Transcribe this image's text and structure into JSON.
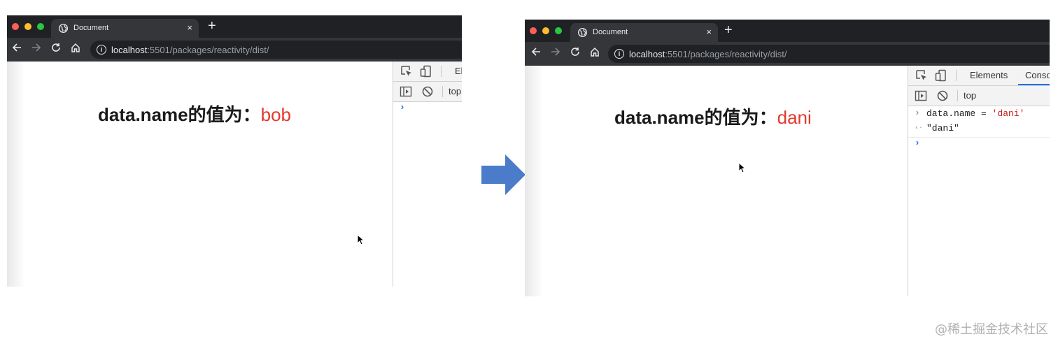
{
  "colors": {
    "tabbar": "#202124",
    "toolbar": "#35363a",
    "dot_close": "#fe5f57",
    "dot_min": "#febc2e",
    "dot_max": "#28c840",
    "value_red": "#e23a2d",
    "arrow_blue": "#4a7cc9",
    "console_string": "#c41a16",
    "console_prompt": "#1a73e8"
  },
  "before": {
    "tab": {
      "title": "Document",
      "close": "×"
    },
    "new_tab": "+",
    "url": {
      "host": "localhost",
      "path": ":5501/packages/reactivity/dist/"
    },
    "page": {
      "label": "data.name的值为：",
      "value": "bob"
    },
    "devtools": {
      "tab_elements": "El",
      "context": "top",
      "console_prompt": "›"
    }
  },
  "after": {
    "tab": {
      "title": "Document",
      "close": "×"
    },
    "new_tab": "+",
    "url": {
      "host": "localhost",
      "path": ":5501/packages/reactivity/dist/"
    },
    "page": {
      "label": "data.name的值为：",
      "value": "dani"
    },
    "devtools": {
      "tab_elements": "Elements",
      "tab_console": "Conso",
      "context": "top",
      "console": {
        "input_prefix": "›",
        "input_expr": "data.name",
        "input_op": "=",
        "input_str": "'dani'",
        "result_prefix": "‹·",
        "result": "\"dani\"",
        "prompt": "›"
      }
    }
  },
  "transition_arrow": "arrow-right",
  "watermark": "@稀土掘金技术社区"
}
